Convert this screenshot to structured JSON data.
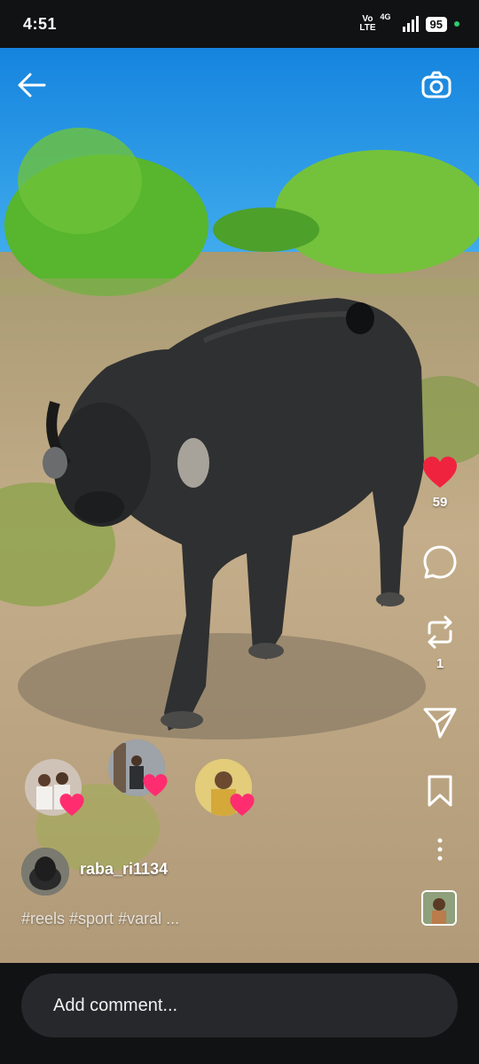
{
  "status": {
    "time": "4:51",
    "network_volte": "Vo\nLTE",
    "network_type": "4G",
    "battery": "95"
  },
  "reel": {
    "likes": "59",
    "reposts": "1",
    "author": "raba_ri1134",
    "caption": "#reels #sport #varal ..."
  },
  "comment": {
    "placeholder": "Add comment..."
  },
  "colors": {
    "like_red": "#f0233f",
    "background_dark": "#111214",
    "comment_box": "#26282c"
  },
  "icons": [
    "back-arrow-icon",
    "camera-icon",
    "heart-icon",
    "comment-icon",
    "repost-icon",
    "send-icon",
    "bookmark-icon",
    "more-icon"
  ]
}
